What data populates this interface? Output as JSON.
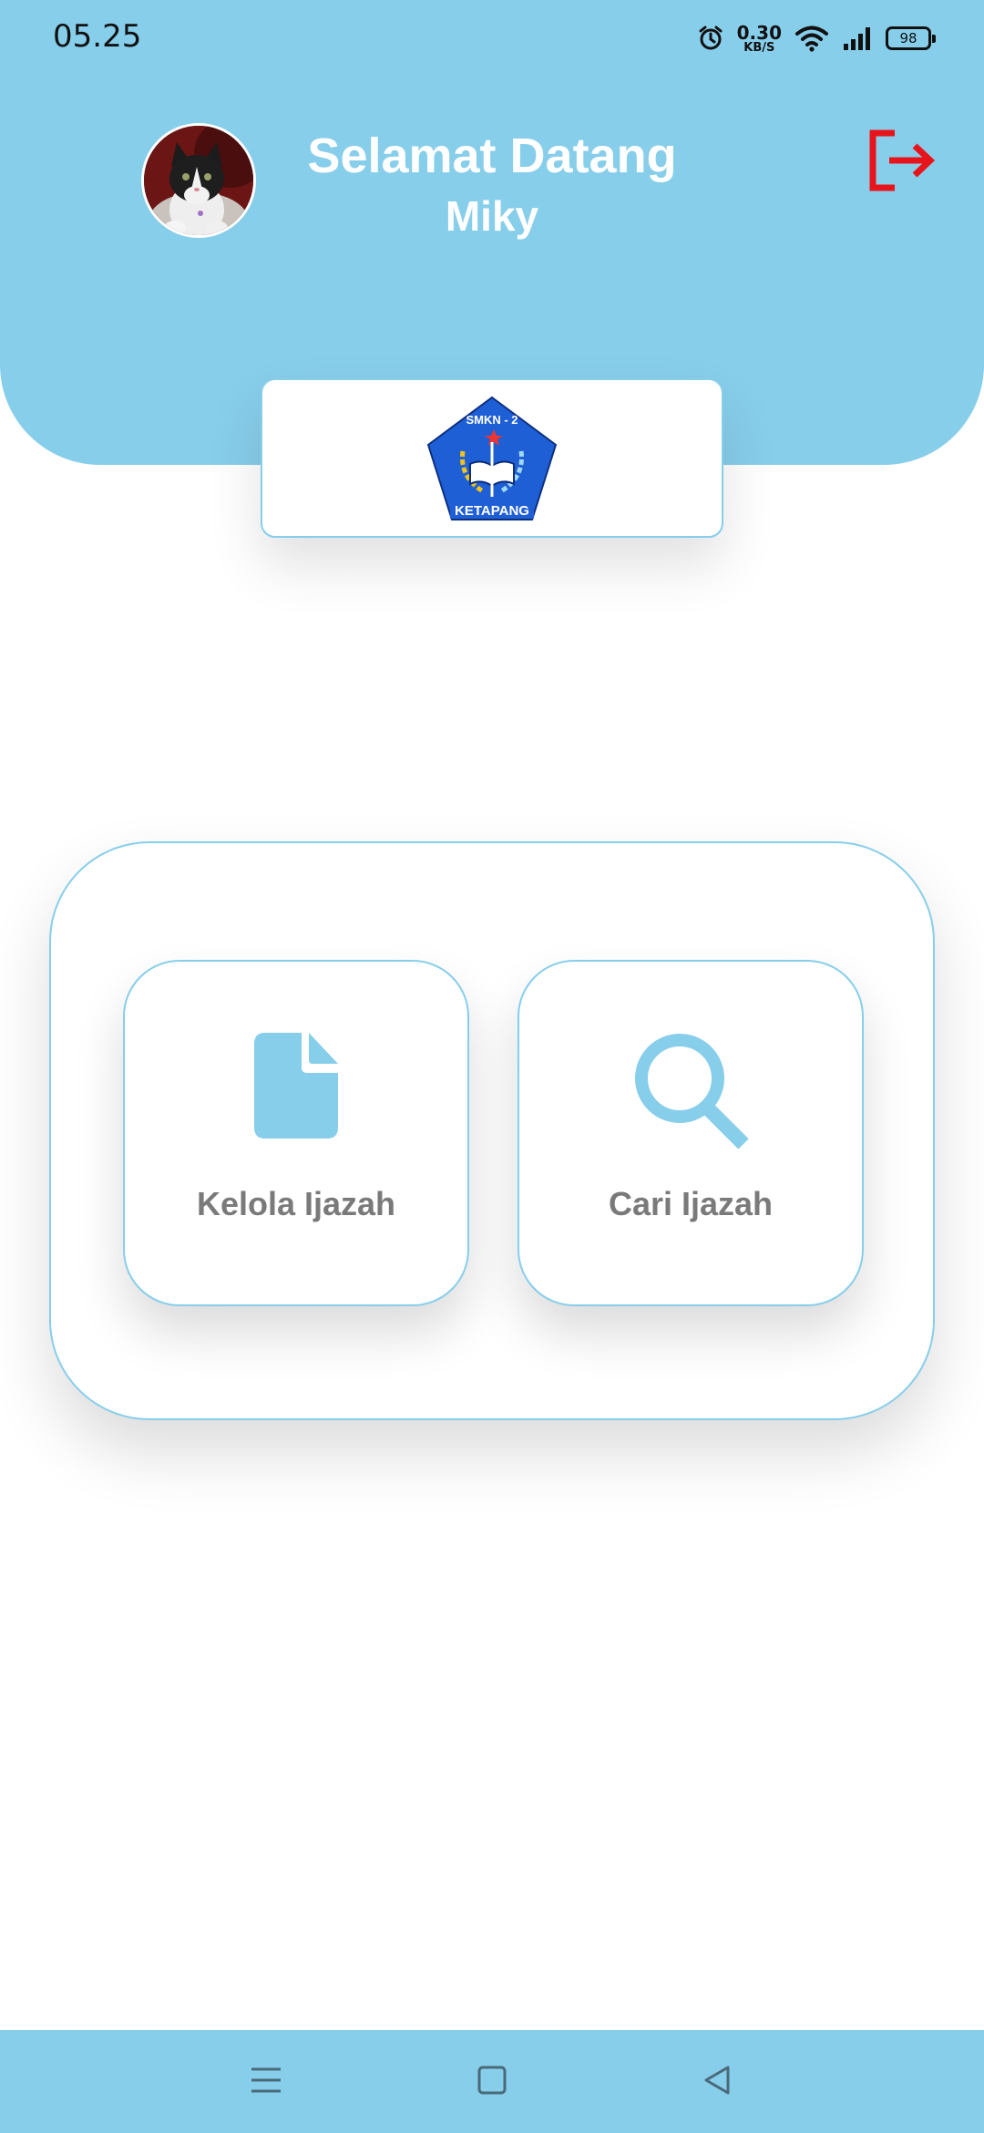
{
  "status_bar": {
    "time": "05.25",
    "network_speed": "0.30",
    "network_unit": "KB/S",
    "battery": "98",
    "icons": [
      "alarm-icon",
      "wifi-icon",
      "signal-icon",
      "battery-icon"
    ]
  },
  "header": {
    "title": "Selamat Datang",
    "user_name": "Miky",
    "logout_icon": "logout-icon",
    "logout_color": "#e8141c"
  },
  "logo": {
    "top_text": "SMKN - 2",
    "bottom_text": "KETAPANG"
  },
  "menu": {
    "items": [
      {
        "label": "Kelola Ijazah",
        "icon": "document-icon"
      },
      {
        "label": "Cari Ijazah",
        "icon": "search-icon"
      }
    ]
  },
  "nav_bar": {
    "icons": [
      "menu-icon",
      "home-square-icon",
      "back-triangle-icon"
    ]
  },
  "colors": {
    "accent": "#87ceeb",
    "text_white": "#ffffff",
    "label_gray": "#7a7a7a",
    "logout_red": "#e8141c",
    "logo_blue": "#1f5fd6"
  }
}
